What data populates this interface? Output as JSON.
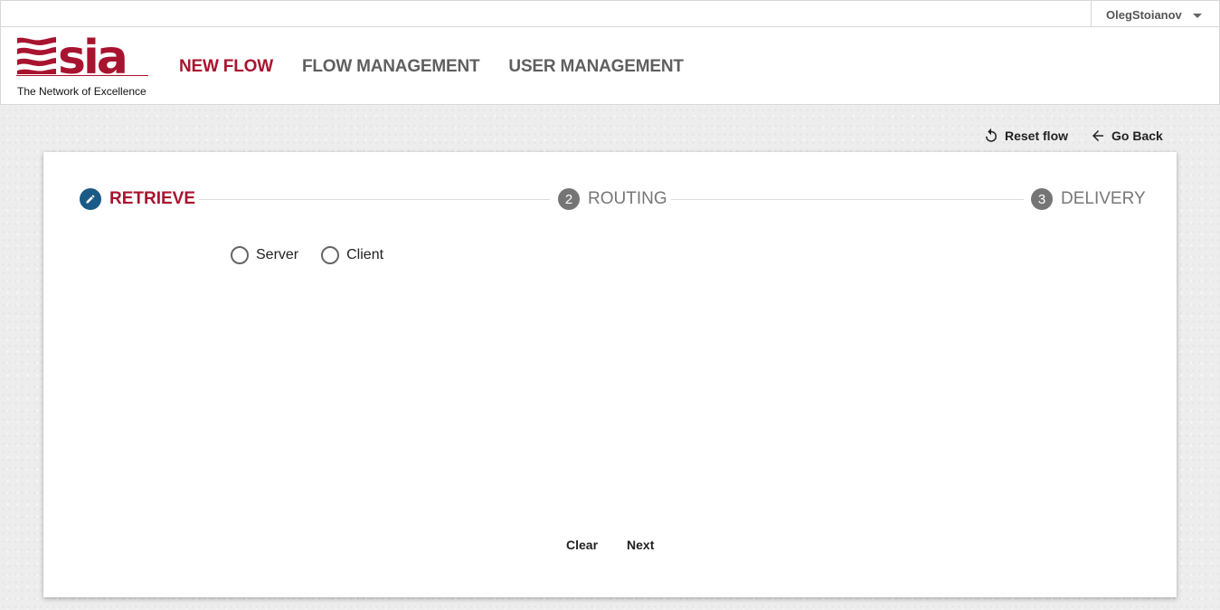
{
  "user": {
    "name": "OlegStoianov",
    "menu_icon": "caret-down-icon"
  },
  "logo": {
    "wordmark": "SIA",
    "tagline": "The Network of Excellence",
    "brand_color": "#a8142f"
  },
  "nav": {
    "items": [
      {
        "label": "NEW FLOW",
        "active": true
      },
      {
        "label": "FLOW MANAGEMENT",
        "active": false
      },
      {
        "label": "USER MANAGEMENT",
        "active": false
      }
    ]
  },
  "actions": {
    "reset_label": "Reset flow",
    "back_label": "Go Back"
  },
  "stepper": {
    "steps": [
      {
        "label": "RETRIEVE",
        "marker": "pencil-icon",
        "active": true
      },
      {
        "label": "ROUTING",
        "number": "2",
        "active": false
      },
      {
        "label": "DELIVERY",
        "number": "3",
        "active": false
      }
    ]
  },
  "retrieve": {
    "options": [
      {
        "label": "Server",
        "selected": false
      },
      {
        "label": "Client",
        "selected": false
      }
    ]
  },
  "buttons": {
    "clear_label": "Clear",
    "next_label": "Next"
  },
  "colors": {
    "accent": "#a8142f",
    "active_step": "#1a5a86",
    "inactive_step": "#757575"
  }
}
